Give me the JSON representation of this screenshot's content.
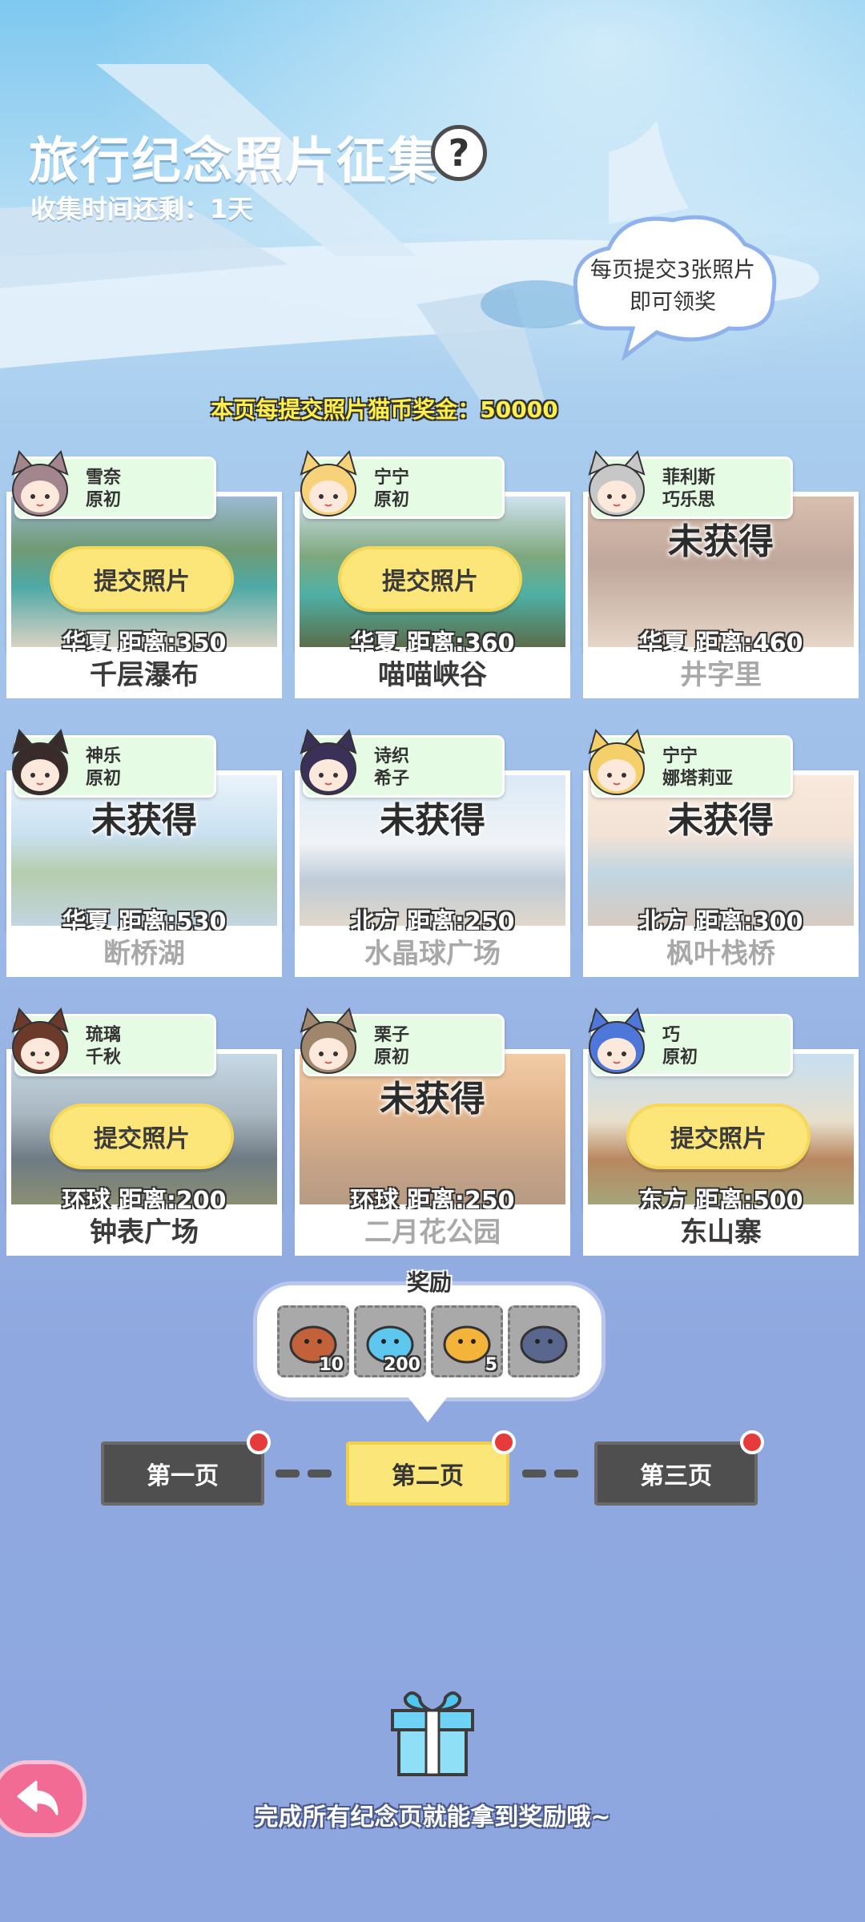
{
  "header": {
    "title": "旅行纪念照片征集",
    "help": "?",
    "time_left": "收集时间还剩：1天"
  },
  "cloud_tip": {
    "line1": "每页提交3张照片",
    "line2": "即可领奖"
  },
  "bonus_text": "本页每提交照片猫币奖金：50000",
  "cards": [
    {
      "names": [
        "雪奈",
        "原初"
      ],
      "state": "submit",
      "state_label": "提交照片",
      "distance": "华夏  距离:350",
      "place": "千层瀑布",
      "dim": false
    },
    {
      "names": [
        "宁宁",
        "原初"
      ],
      "state": "submit",
      "state_label": "提交照片",
      "distance": "华夏  距离:360",
      "place": "喵喵峡谷",
      "dim": false
    },
    {
      "names": [
        "菲利斯",
        "巧乐思"
      ],
      "state": "locked",
      "state_label": "未获得",
      "distance": "华夏  距离:460",
      "place": "井字里",
      "dim": true
    },
    {
      "names": [
        "神乐",
        "原初"
      ],
      "state": "locked",
      "state_label": "未获得",
      "distance": "华夏  距离:530",
      "place": "断桥湖",
      "dim": true
    },
    {
      "names": [
        "诗织",
        "希子"
      ],
      "state": "locked",
      "state_label": "未获得",
      "distance": "北方  距离:250",
      "place": "水晶球广场",
      "dim": true
    },
    {
      "names": [
        "宁宁",
        "娜塔莉亚"
      ],
      "state": "locked",
      "state_label": "未获得",
      "distance": "北方  距离:300",
      "place": "枫叶栈桥",
      "dim": true
    },
    {
      "names": [
        "琉璃",
        "千秋"
      ],
      "state": "submit",
      "state_label": "提交照片",
      "distance": "环球  距离:200",
      "place": "钟表广场",
      "dim": false
    },
    {
      "names": [
        "栗子",
        "原初"
      ],
      "state": "locked",
      "state_label": "未获得",
      "distance": "环球  距离:250",
      "place": "二月花公园",
      "dim": true
    },
    {
      "names": [
        "巧",
        "原初"
      ],
      "state": "submit",
      "state_label": "提交照片",
      "distance": "东方  距离:500",
      "place": "东山寨",
      "dim": false
    }
  ],
  "reward": {
    "title": "奖励",
    "items": [
      {
        "icon": "fish-bag-icon",
        "count": "10"
      },
      {
        "icon": "blue-slime-icon",
        "count": "200"
      },
      {
        "icon": "dried-fish-icon",
        "count": "5"
      },
      {
        "icon": "cat-plush-icon",
        "count": ""
      }
    ]
  },
  "pages": [
    {
      "label": "第一页",
      "active": false
    },
    {
      "label": "第二页",
      "active": true
    },
    {
      "label": "第三页",
      "active": false
    }
  ],
  "footer_text": "完成所有纪念页就能拿到奖励哦~",
  "colors": {
    "submit_button": "#fce67a",
    "tag_bg": "#e6fbe4",
    "active_page": "#fbe67a",
    "inactive_page": "#4f4f4f",
    "notification_dot": "#e53b3b",
    "back_button": "#f26b95"
  }
}
